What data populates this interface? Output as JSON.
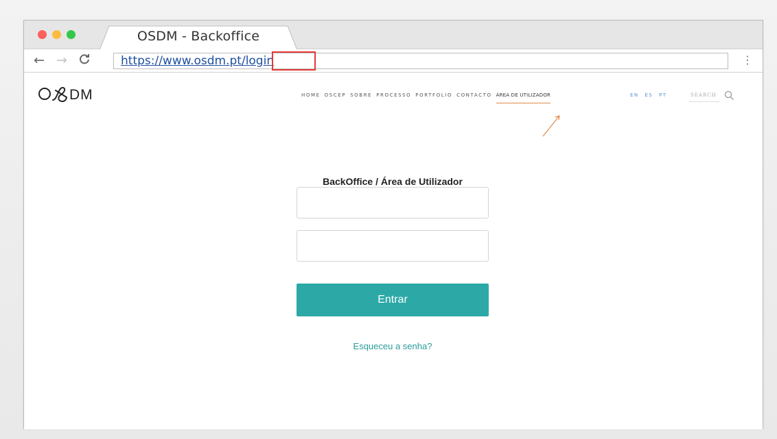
{
  "window": {
    "tab_title": "OSDM - Backoffice"
  },
  "toolbar": {
    "back_icon": "←",
    "forward_icon": "→",
    "reload_icon": "C",
    "url": "https://www.osdm.pt/login",
    "menu_icon": "⋮"
  },
  "site": {
    "logo": "O&DM",
    "nav": {
      "home": "HOME",
      "oscep": "OSCEP",
      "sobre": "SOBRE",
      "processo": "PROCESSO",
      "portfolio": "PORTFOLIO",
      "contacto": "CONTACTO",
      "area_utilizador": "ÁREA DE UTILIZADOR"
    },
    "languages": {
      "en": "EN",
      "es": "ES",
      "pt": "PT"
    },
    "search_label": "SEARCH"
  },
  "login": {
    "heading": "BackOffice / Área de Utilizador",
    "username_value": "",
    "password_value": "",
    "submit_label": "Entrar",
    "forgot_label": "Esqueceu a senha?"
  },
  "colors": {
    "accent": "#2ca9a7",
    "highlight": "#e53935",
    "annotation_arrow": "#e08a4a",
    "link_blue": "#1f4fa1"
  }
}
